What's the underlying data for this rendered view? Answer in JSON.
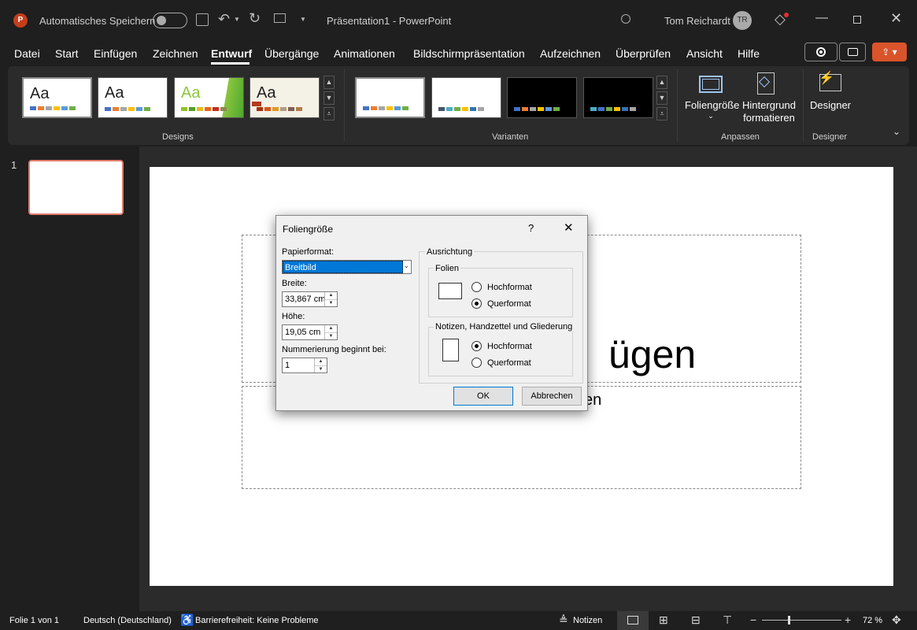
{
  "titlebar": {
    "autosave_label": "Automatisches Speichern",
    "doc_title": "Präsentation1 - PowerPoint",
    "user_name": "Tom Reichardt",
    "user_initials": "TR"
  },
  "menu": [
    "Datei",
    "Start",
    "Einfügen",
    "Zeichnen",
    "Entwurf",
    "Übergänge",
    "Animationen",
    "Bildschirmpräsentation",
    "Aufzeichnen",
    "Überprüfen",
    "Ansicht",
    "Hilfe"
  ],
  "active_menu": "Entwurf",
  "ribbon": {
    "designs_label": "Designs",
    "variants_label": "Varianten",
    "customize_label": "Anpassen",
    "designer_group_label": "Designer",
    "slide_size_label": "Foliengröße",
    "format_bg_label_1": "Hintergrund",
    "format_bg_label_2": "formatieren",
    "designer_label": "Designer",
    "theme_aa": "Aa"
  },
  "slide_panel": {
    "slide_number": "1"
  },
  "slide": {
    "title_partial": "ügen",
    "subtitle_partial": "en"
  },
  "dialog": {
    "title": "Foliengröße",
    "help": "?",
    "paper_label": "Papierformat:",
    "paper_value": "Breitbild",
    "width_label": "Breite:",
    "width_value": "33,867 cm",
    "height_label": "Höhe:",
    "height_value": "19,05 cm",
    "numbering_label": "Nummerierung beginnt bei:",
    "numbering_value": "1",
    "orientation_label": "Ausrichtung",
    "slides_label": "Folien",
    "portrait": "Hochformat",
    "landscape": "Querformat",
    "notes_label": "Notizen, Handzettel und Gliederung",
    "ok": "OK",
    "cancel": "Abbrechen"
  },
  "status": {
    "slide_info": "Folie 1 von 1",
    "language": "Deutsch (Deutschland)",
    "accessibility": "Barrierefreiheit: Keine Probleme",
    "notes": "Notizen",
    "zoom": "72 %"
  },
  "colors": {
    "accent": "#c43e1c",
    "share_button": "#d9542a",
    "selection": "#0078d7"
  }
}
